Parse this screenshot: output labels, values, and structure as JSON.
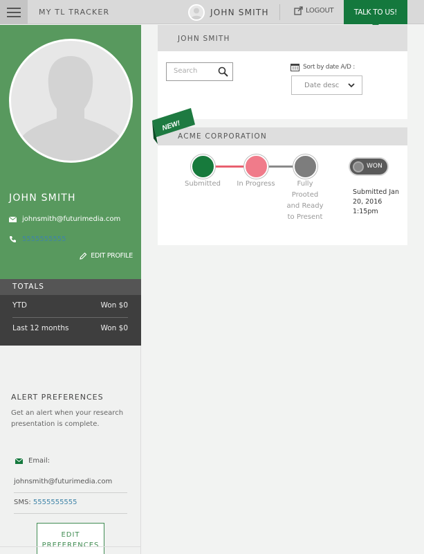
{
  "topbar": {
    "app_title": "MY TL TRACKER",
    "user_name": "JOHN SMITH",
    "logout_label": "LOGOUT",
    "talk_label": "TALK TO US!"
  },
  "profile": {
    "name": "JOHN SMITH",
    "email": "johnsmith@futurimedia.com",
    "phone": "5555555555",
    "edit_label": "EDIT PROFILE"
  },
  "totals": {
    "title": "TOTALS",
    "rows": [
      {
        "label": "YTD",
        "value": "Won $0"
      },
      {
        "label": "Last 12 months",
        "value": "Won $0"
      }
    ]
  },
  "alerts": {
    "title": "ALERT PREFERENCES",
    "description": "Get an alert when your research presentation is complete.",
    "email_label": "Email:",
    "email_value": "johnsmith@futurimedia.com",
    "sms_label": "SMS:",
    "sms_value": "5555555555",
    "edit_label_line1": "EDIT",
    "edit_label_line2": "PREFERENCES"
  },
  "main": {
    "header_name": "JOHN SMITH",
    "search_placeholder": "Search",
    "sort_label": "Sort by date A/D :",
    "sort_selected": "Date desc",
    "deal": {
      "badge": "NEW!",
      "company": "ACME CORPORATION",
      "stages": [
        {
          "label": "Submitted",
          "color": "#177a3c"
        },
        {
          "label": "In Progress",
          "color": "#f07b8a"
        },
        {
          "label": "Fully Prooted and Ready to Present",
          "color": "#7d7d7d"
        }
      ],
      "toggle_label": "WON",
      "submitted_info": "Submitted Jan 20, 2016 1:15pm"
    }
  },
  "colors": {
    "brand_green": "#14783d",
    "profile_green": "#58995e",
    "link_blue": "#3f84a8",
    "progress_red": "#e8606f"
  }
}
